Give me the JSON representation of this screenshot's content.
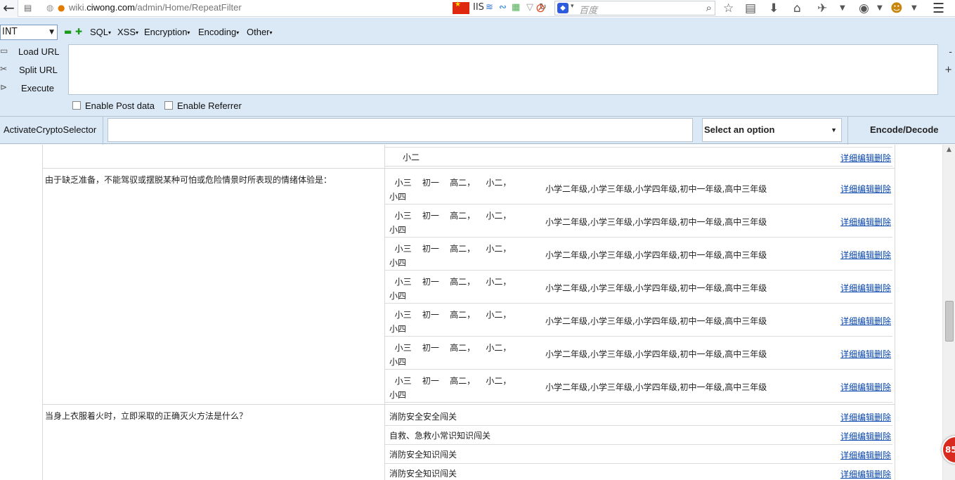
{
  "browser": {
    "url_prefix": "wiki.",
    "url_host": "ciwong.com",
    "url_path": "/admin/Home/RepeatFilter",
    "iis_label": "IIS",
    "search_placeholder": "百度"
  },
  "hackbar": {
    "type_select": "INT",
    "menus": [
      "SQL",
      "XSS",
      "Encryption",
      "Encoding",
      "Other"
    ],
    "actions": [
      "Load URL",
      "Split URL",
      "Execute"
    ],
    "side_minus": "-",
    "side_plus": "+",
    "enable_post": "Enable Post data",
    "enable_referrer": "Enable Referrer",
    "crypto_label": "ActivateCryptoSelector",
    "crypto_option": "Select an option",
    "encode_decode": "Encode/Decode"
  },
  "content": {
    "top_row": {
      "text": "小二",
      "action": "详细编辑删除"
    },
    "block1": {
      "question": "由于缺乏准备，不能驾驭或摆脱某种可怕或危险情景时所表现的情绪体验是：",
      "rows": [
        {
          "grades_short": "  小三    初一    高二，    小二，\n小四",
          "grades_full": "小学二年级,小学三年级,小学四年级,初中一年级,高中三年级",
          "action": "详细编辑删除"
        },
        {
          "grades_short": "  小三    初一    高二，    小二，\n小四",
          "grades_full": "小学二年级,小学三年级,小学四年级,初中一年级,高中三年级",
          "action": "详细编辑删除"
        },
        {
          "grades_short": "  小三    初一    高二，    小二，\n小四",
          "grades_full": "小学二年级,小学三年级,小学四年级,初中一年级,高中三年级",
          "action": "详细编辑删除"
        },
        {
          "grades_short": "  小三    初一    高二，    小二，\n小四",
          "grades_full": "小学二年级,小学三年级,小学四年级,初中一年级,高中三年级",
          "action": "详细编辑删除"
        },
        {
          "grades_short": "  小三    初一    高二，    小二，\n小四",
          "grades_full": "小学二年级,小学三年级,小学四年级,初中一年级,高中三年级",
          "action": "详细编辑删除"
        },
        {
          "grades_short": "  小三    初一    高二，    小二，\n小四",
          "grades_full": "小学二年级,小学三年级,小学四年级,初中一年级,高中三年级",
          "action": "详细编辑删除"
        },
        {
          "grades_short": "  小三    初一    高二，    小二，\n小四",
          "grades_full": "小学二年级,小学三年级,小学四年级,初中一年级,高中三年级",
          "action": "详细编辑删除"
        }
      ]
    },
    "block2": {
      "question": "当身上衣服着火时，立即采取的正确灭火方法是什么？",
      "rows": [
        {
          "label": "消防安全安全闯关",
          "action": "详细编辑删除"
        },
        {
          "label": "自救、急救小常识知识闯关",
          "action": "详细编辑删除"
        },
        {
          "label": "消防安全知识闯关",
          "action": "详细编辑删除"
        },
        {
          "label": "消防安全知识闯关",
          "action": "详细编辑删除"
        }
      ]
    },
    "badge": "85"
  }
}
